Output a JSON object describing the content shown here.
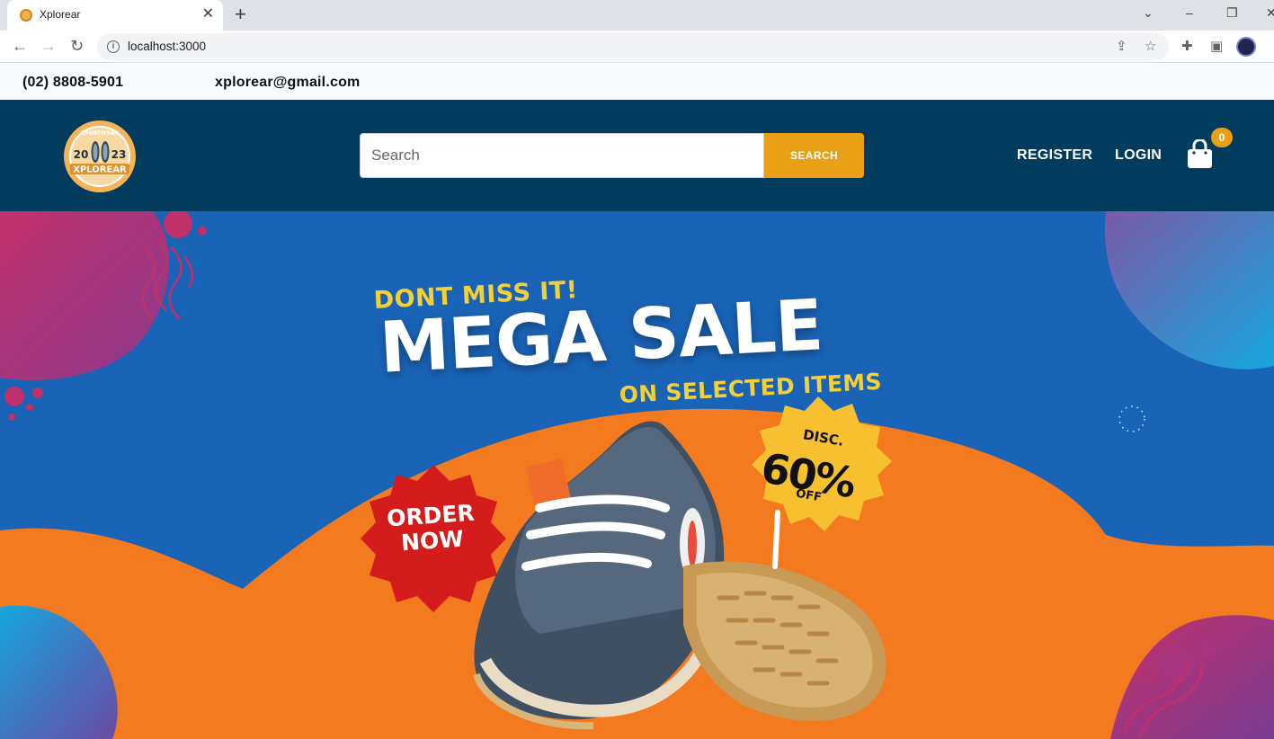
{
  "browser": {
    "tab_title": "Xplorear",
    "url": "localhost:3000"
  },
  "topbar": {
    "phone": "(02) 8808-5901",
    "email": "xplorear@gmail.com"
  },
  "header": {
    "search_placeholder": "Search",
    "search_button": "SEARCH",
    "nav": [
      "REGISTER",
      "LOGIN"
    ],
    "cart_count": "0",
    "logo_text": "XPLOREAR",
    "logo_year_left": "20",
    "logo_year_right": "23",
    "logo_tagline": "SPORTWEAR"
  },
  "hero": {
    "kicker": "DONT MISS IT!",
    "headline": "MEGA SALE",
    "subline": "ON SELECTED ITEMS",
    "cta_line1": "ORDER",
    "cta_line2": "NOW",
    "badge_top": "DISC.",
    "badge_value": "60%",
    "badge_bottom": "OFF"
  },
  "colors": {
    "header_bg": "#013c5f",
    "accent": "#e9a014",
    "hero_blue": "#1a64b8",
    "hero_orange": "#f47a20",
    "sale_yellow": "#f3cf3a",
    "cta_red": "#d41c1c"
  }
}
